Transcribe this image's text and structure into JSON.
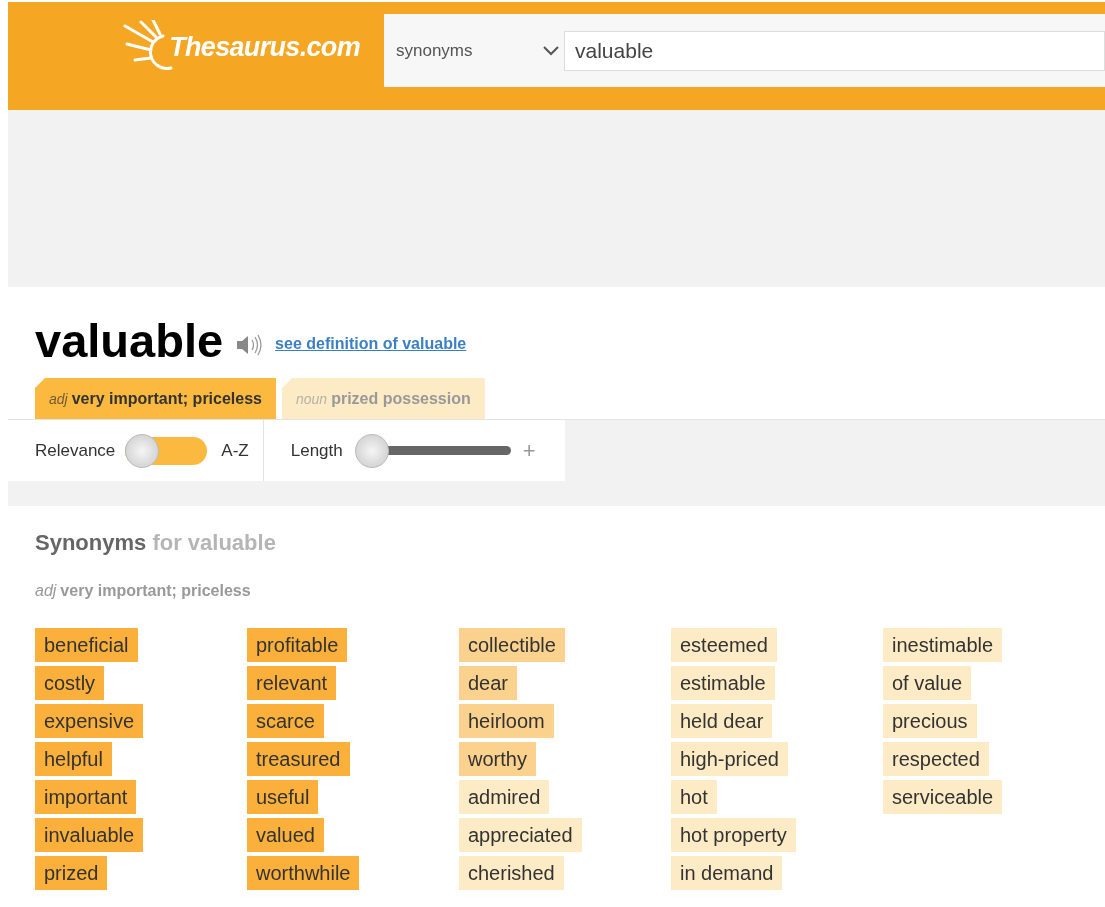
{
  "header": {
    "logo": "Thesaurus.com",
    "search_type": "synonyms",
    "search_value": "valuable"
  },
  "entry": {
    "word": "valuable",
    "definition_link": "see definition of valuable"
  },
  "tabs": [
    {
      "pos": "adj",
      "meaning": "very important; priceless",
      "selected": true
    },
    {
      "pos": "noun",
      "meaning": "prized possession",
      "selected": false
    }
  ],
  "controls": {
    "sort_left": "Relevance",
    "sort_right": "A-Z",
    "sort_az": false,
    "length_label": "Length",
    "length_plus": "+",
    "length": {
      "level": 0
    }
  },
  "synonyms": {
    "heading": "Synonyms",
    "heading_suffix": "for valuable",
    "pos": "adj",
    "meaning": "very important; priceless",
    "words": [
      {
        "text": "beneficial",
        "kind": "strong"
      },
      {
        "text": "costly",
        "kind": "strong"
      },
      {
        "text": "expensive",
        "kind": "strong"
      },
      {
        "text": "helpful",
        "kind": "strong"
      },
      {
        "text": "important",
        "kind": "strong"
      },
      {
        "text": "invaluable",
        "kind": "strong"
      },
      {
        "text": "prized",
        "kind": "strong"
      },
      {
        "text": "profitable",
        "kind": "strong"
      },
      {
        "text": "relevant",
        "kind": "strong"
      },
      {
        "text": "scarce",
        "kind": "strong"
      },
      {
        "text": "treasured",
        "kind": "strong"
      },
      {
        "text": "useful",
        "kind": "strong"
      },
      {
        "text": "valued",
        "kind": "strong"
      },
      {
        "text": "worthwhile",
        "kind": "strong"
      },
      {
        "text": "collectible",
        "kind": "medium"
      },
      {
        "text": "dear",
        "kind": "medium"
      },
      {
        "text": "heirloom",
        "kind": "medium"
      },
      {
        "text": "worthy",
        "kind": "medium"
      },
      {
        "text": "admired",
        "kind": "weak"
      },
      {
        "text": "appreciated",
        "kind": "weak"
      },
      {
        "text": "cherished",
        "kind": "weak"
      },
      {
        "text": "esteemed",
        "kind": "weak"
      },
      {
        "text": "estimable",
        "kind": "weak"
      },
      {
        "text": "held dear",
        "kind": "weak"
      },
      {
        "text": "high-priced",
        "kind": "weak"
      },
      {
        "text": "hot",
        "kind": "weak"
      },
      {
        "text": "hot property",
        "kind": "weak"
      },
      {
        "text": "in demand",
        "kind": "weak"
      },
      {
        "text": "inestimable",
        "kind": "weak"
      },
      {
        "text": "of value",
        "kind": "weak"
      },
      {
        "text": "precious",
        "kind": "weak"
      },
      {
        "text": "respected",
        "kind": "weak"
      },
      {
        "text": "serviceable",
        "kind": "weak"
      }
    ]
  }
}
